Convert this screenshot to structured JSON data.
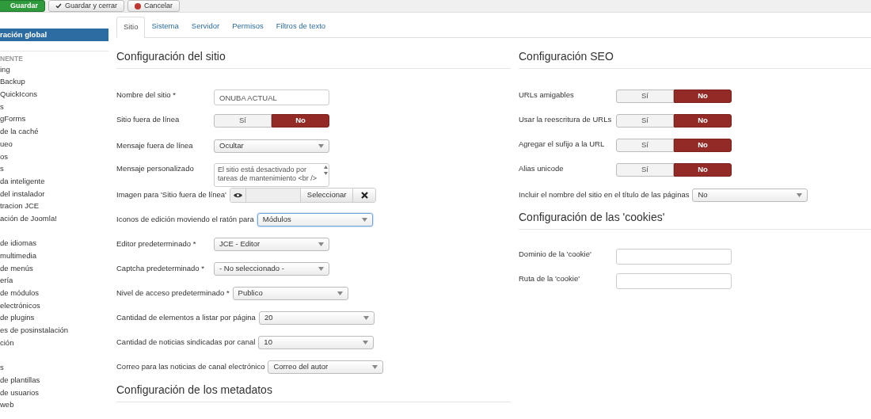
{
  "toolbar": [
    {
      "label": "Guardar",
      "kind": "primary"
    },
    {
      "label": "Guardar y cerrar",
      "kind": "check"
    },
    {
      "label": "Cancelar",
      "kind": "cancel"
    }
  ],
  "sidebar": {
    "items": [
      {
        "label": "ración global",
        "kind": "item",
        "selected": true
      },
      {
        "label": "NENTE",
        "kind": "heading"
      },
      {
        "label": "ing",
        "kind": "item",
        "selected": false
      },
      {
        "label": "Backup",
        "kind": "item",
        "selected": false
      },
      {
        "label": "QuickIcons",
        "kind": "item",
        "selected": false
      },
      {
        "label": "s",
        "kind": "item",
        "selected": false
      },
      {
        "label": "gForms",
        "kind": "item",
        "selected": false
      },
      {
        "label": "de la caché",
        "kind": "item",
        "selected": false
      },
      {
        "label": "ueo",
        "kind": "item",
        "selected": false
      },
      {
        "label": "os",
        "kind": "item",
        "selected": false
      },
      {
        "label": "s",
        "kind": "item",
        "selected": false
      },
      {
        "label": "da inteligente",
        "kind": "item",
        "selected": false
      },
      {
        "label": "del instalador",
        "kind": "item",
        "selected": false
      },
      {
        "label": "tracion JCE",
        "kind": "item",
        "selected": false
      },
      {
        "label": "ación de Joomla!",
        "kind": "item",
        "selected": false
      },
      {
        "kind": "gap"
      },
      {
        "label": "de idiomas",
        "kind": "item",
        "selected": false
      },
      {
        "label": "multimedia",
        "kind": "item",
        "selected": false
      },
      {
        "label": "de menús",
        "kind": "item",
        "selected": false
      },
      {
        "label": "ería",
        "kind": "item",
        "selected": false
      },
      {
        "label": "de módulos",
        "kind": "item",
        "selected": false
      },
      {
        "label": "electrónicos",
        "kind": "item",
        "selected": false
      },
      {
        "label": "de plugins",
        "kind": "item",
        "selected": false
      },
      {
        "label": "es de posinstalación",
        "kind": "item",
        "selected": false
      },
      {
        "label": "ción",
        "kind": "item",
        "selected": false
      },
      {
        "kind": "gap"
      },
      {
        "label": "s",
        "kind": "item",
        "selected": false
      },
      {
        "label": "de plantillas",
        "kind": "item",
        "selected": false
      },
      {
        "label": "de usuarios",
        "kind": "item",
        "selected": false
      },
      {
        "label": "web",
        "kind": "item",
        "selected": false
      }
    ]
  },
  "tabs": [
    {
      "label": "Sitio",
      "selected": true
    },
    {
      "label": "Sistema",
      "selected": false
    },
    {
      "label": "Servidor",
      "selected": false
    },
    {
      "label": "Permisos",
      "selected": false
    },
    {
      "label": "Filtros de texto",
      "selected": false
    }
  ],
  "left": {
    "title": "Configuración del sitio",
    "fields": [
      {
        "label": "Nombre del sitio *",
        "kind": "text",
        "value": "ONUBA ACTUAL"
      },
      {
        "label": "Sitio fuera de línea",
        "kind": "toggle",
        "yes": "Sí",
        "no": "No",
        "on": false
      },
      {
        "label": "Mensaje fuera de línea",
        "kind": "select",
        "value": "Ocultar",
        "focused": false
      },
      {
        "label": "Mensaje personalizado",
        "kind": "textarea",
        "value": "El sitio está desactivado por tareas de mantenimiento <br />"
      },
      {
        "label": "Imagen para 'Sitio fuera de línea'",
        "kind": "media",
        "button": "Seleccionar"
      },
      {
        "label": "Iconos de edición moviendo el ratón para",
        "kind": "select",
        "value": "Módulos",
        "focused": true
      },
      {
        "label": "Editor predeterminado *",
        "kind": "select",
        "value": "JCE - Editor",
        "focused": false
      },
      {
        "label": "Captcha predeterminado *",
        "kind": "select",
        "value": "- No seleccionado -",
        "focused": false
      },
      {
        "label": "Nivel de acceso predeterminado *",
        "kind": "select",
        "value": "Publico",
        "focused": false
      },
      {
        "label": "Cantidad de elementos a listar por página",
        "kind": "select",
        "value": "20",
        "focused": false
      },
      {
        "label": "Cantidad de noticias sindicadas por canal",
        "kind": "select",
        "value": "10",
        "focused": false
      },
      {
        "label": "Correo para las noticias de canal electrónico",
        "kind": "select",
        "value": "Correo del autor",
        "focused": false
      }
    ],
    "next_title": "Configuración de los metadatos"
  },
  "right": {
    "title": "Configuración SEO",
    "fields": [
      {
        "label": "URLs amigables",
        "kind": "toggle",
        "yes": "Sí",
        "no": "No",
        "on": false
      },
      {
        "label": "Usar la reescritura de URLs",
        "kind": "toggle",
        "yes": "Sí",
        "no": "No",
        "on": false
      },
      {
        "label": "Agregar el sufijo a la URL",
        "kind": "toggle",
        "yes": "Sí",
        "no": "No",
        "on": false
      },
      {
        "label": "Alias unicode",
        "kind": "toggle",
        "yes": "Sí",
        "no": "No",
        "on": false
      },
      {
        "label": "Incluir el nombre del sitio en el título de las páginas",
        "kind": "select",
        "value": "No",
        "focused": false
      }
    ],
    "cookies_title": "Configuración de las 'cookies'",
    "cookie_fields": [
      {
        "label": "Dominio de la 'cookie'",
        "kind": "text"
      },
      {
        "label": "Ruta de la 'cookie'",
        "kind": "text"
      }
    ]
  }
}
